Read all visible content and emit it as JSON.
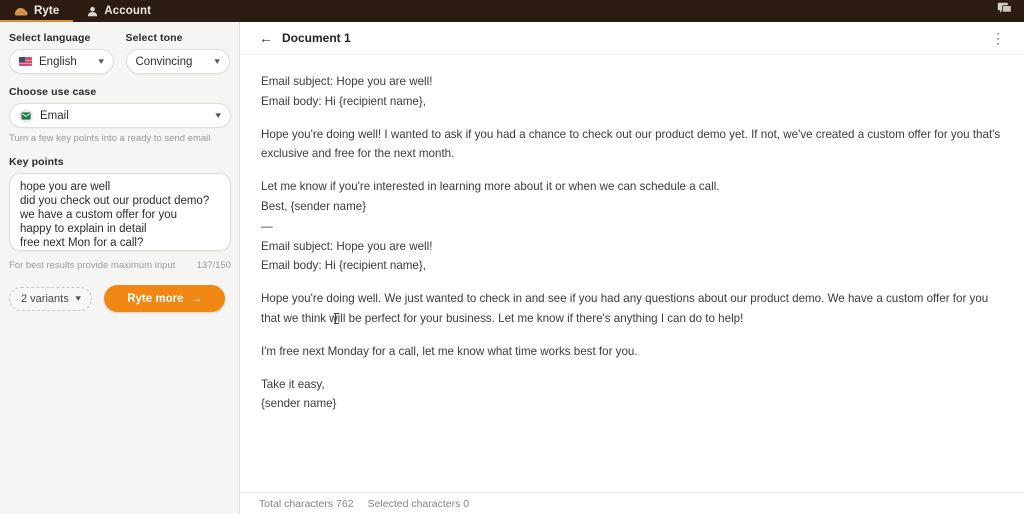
{
  "topbar": {
    "brand": {
      "label": "Ryte",
      "icon": "ryte-logo-icon"
    },
    "tabs": [
      {
        "label": "Ryte",
        "icon": "ryte-logo-icon",
        "active": true
      },
      {
        "label": "Account",
        "icon": "user-icon",
        "active": false
      }
    ],
    "chat_icon": "chat-bubble-icon",
    "background_color": "#2b1b10",
    "active_underline_color": "#d89030"
  },
  "sidebar": {
    "language": {
      "label": "Select language",
      "value": "English",
      "icon": "us-flag-icon",
      "chevron": "chevron-down-icon"
    },
    "tone": {
      "label": "Select tone",
      "value": "Convincing",
      "chevron": "chevron-down-icon"
    },
    "use_case": {
      "label": "Choose use case",
      "value": "Email",
      "icon": "envelope-icon",
      "chevron": "chevron-down-icon",
      "hint": "Turn a few key points into a ready to send email"
    },
    "key_points": {
      "label": "Key points",
      "value": "hope you are well\ndid you check out our product demo?\nwe have a custom offer for you\nhappy to explain in detail\nfree next Mon for a call?",
      "placeholder": "Enter your key points",
      "hint": "For best results provide maximum input",
      "counter": "137/150"
    },
    "variants": {
      "label": "2 variants",
      "chevron": "chevron-down-icon"
    },
    "submit": {
      "label": "Ryte more",
      "arrow": "→",
      "color": "#ef8712"
    }
  },
  "document": {
    "back_icon": "back-arrow-icon",
    "title": "Document 1",
    "menu_icon": "kebab-menu-icon",
    "paragraphs": [
      {
        "text": "Email subject: Hope you are well!",
        "gap": false
      },
      {
        "text": "Email body: Hi {recipient name},",
        "gap": false
      },
      {
        "text": "Hope you're doing well! I wanted to ask if you had a chance to check out our product demo yet. If not, we've created a custom offer for you that's exclusive and free for the next month.",
        "gap": true
      },
      {
        "text": "Let me know if you're interested in learning more about it or when we can schedule a call.",
        "gap": true
      },
      {
        "text": "Best, {sender name}",
        "gap": false
      },
      {
        "text": "—",
        "gap": false
      },
      {
        "text": "Email subject: Hope you are well!",
        "gap": false
      },
      {
        "text": "Email body: Hi {recipient name},",
        "gap": false
      },
      {
        "text": "Hope you're doing well. We just wanted to check in and see if you had any questions about our product demo. We have a custom offer for you that we think will be perfect for your business. Let me know if there's anything I can do to help!",
        "gap": true
      },
      {
        "text": "I'm free next Monday for a call, let me know what time works best for you.",
        "gap": true
      },
      {
        "text": "Take it easy,",
        "gap": true
      },
      {
        "text": "{sender name}",
        "gap": false
      }
    ]
  },
  "statusbar": {
    "total_characters": "Total characters 762",
    "selected_characters": "Selected characters 0"
  }
}
